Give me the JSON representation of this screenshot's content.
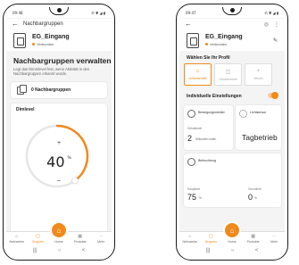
{
  "accent": "#f08a1c",
  "left": {
    "status": {
      "time": "09:48",
      "right": "✆ ▼ ◢ ▮"
    },
    "topbar": {
      "title": "Nachbargruppen"
    },
    "device": {
      "name": "EG_Eingang",
      "status": "Verbunden"
    },
    "heading": "Nachbargruppen verwalten",
    "description": "Legt das Dimmlevel fest, wenn Aktivität in den Nachbargruppen erkannt wurde.",
    "groups": {
      "label": "0 Nachbargruppen"
    },
    "dim": {
      "title": "Dimlevel",
      "plus": "+",
      "minus": "–",
      "value": "40",
      "unit": "%",
      "level": 0.4
    },
    "tabs": [
      {
        "label": "Netzwerke",
        "icon": "⌂"
      },
      {
        "label": "Gruppen",
        "icon": "▢"
      },
      {
        "label": "Home",
        "icon": "⌂"
      },
      {
        "label": "Produkte",
        "icon": "▦"
      },
      {
        "label": "Mehr",
        "icon": "⋯"
      }
    ],
    "nav": {
      "recent": "|||",
      "home": "○",
      "back": "<"
    }
  },
  "right": {
    "status": {
      "time": "09:47",
      "right": "✆ ▼ ◢ ▮"
    },
    "device": {
      "name": "EG_Eingang",
      "status": "Verbunden"
    },
    "profile_heading": "Wählen Sie Ihr Profil",
    "profiles": [
      {
        "label": "Vollautomatik",
        "icon": "☼",
        "selected": true
      },
      {
        "label": "Schaltbetrieb",
        "icon": "◫",
        "selected": false
      },
      {
        "label": "Neues",
        "icon": "+",
        "selected": false
      }
    ],
    "individual": {
      "label": "Individuelle Einstellungen",
      "enabled": true
    },
    "settings": {
      "presence": {
        "title": "Bewegungsmelder",
        "sub": "Gehaltezeit",
        "value": "2",
        "unit": "Sekunden unten"
      },
      "light": {
        "title": "Lichtsensor",
        "value": "Tagbetrieb"
      },
      "lighting": {
        "title": "Beleuchtung"
      },
      "bottom": {
        "label_a": "Hauptlicht",
        "value_a": "75",
        "unit_a": "%",
        "label_b": "Grundlicht",
        "value_b": "0",
        "unit_b": "%"
      }
    },
    "tabs": [
      {
        "label": "Netzwerke",
        "icon": "⌂"
      },
      {
        "label": "Gruppen",
        "icon": "▢"
      },
      {
        "label": "Home",
        "icon": "⌂"
      },
      {
        "label": "Produkte",
        "icon": "▦"
      },
      {
        "label": "Mehr",
        "icon": "⋯"
      }
    ],
    "nav": {
      "recent": "|||",
      "home": "○",
      "back": "<"
    }
  }
}
